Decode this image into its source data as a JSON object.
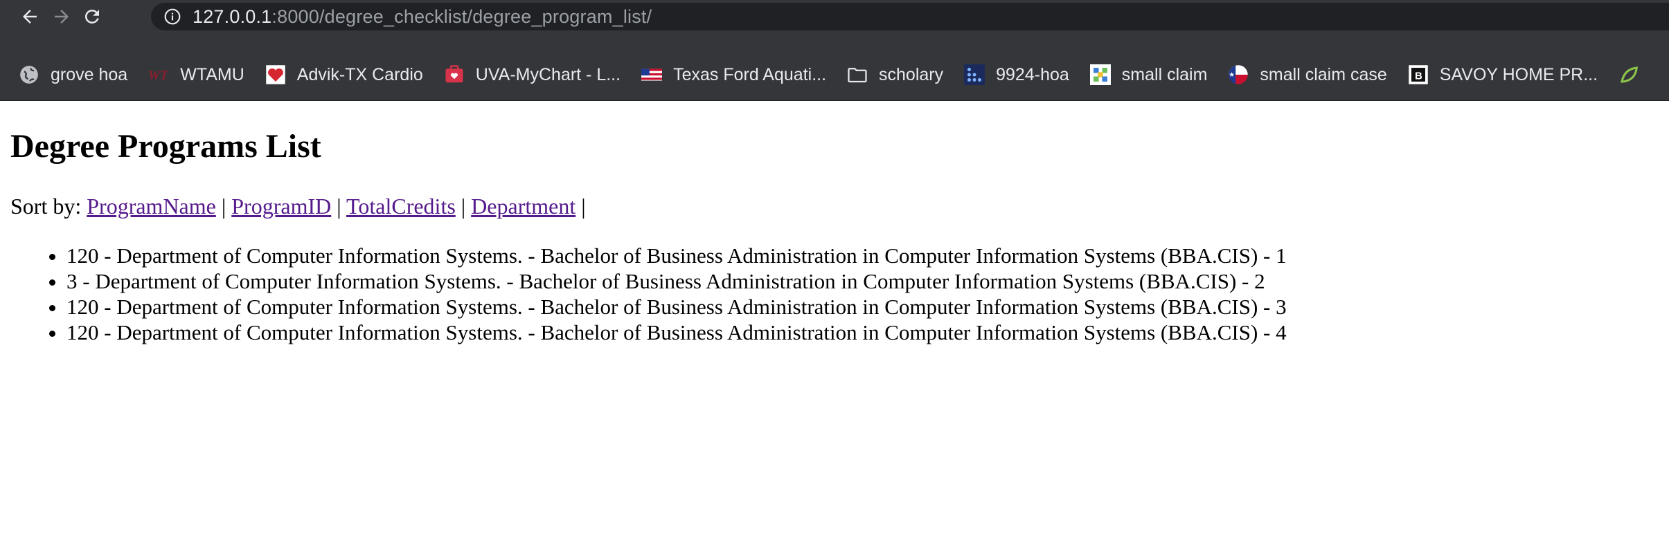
{
  "browser": {
    "url_host": "127.0.0.1",
    "url_path": ":8000/degree_checklist/degree_program_list/",
    "bookmarks": [
      {
        "label": "grove hoa",
        "icon": "globe-icon"
      },
      {
        "label": "WTAMU",
        "icon": "wtamu-logo-icon"
      },
      {
        "label": "Advik-TX Cardio",
        "icon": "heart-balloon-icon"
      },
      {
        "label": "UVA-MyChart - L...",
        "icon": "mychart-icon"
      },
      {
        "label": "Texas Ford Aquati...",
        "icon": "flag-icon"
      },
      {
        "label": "scholary",
        "icon": "folder-icon"
      },
      {
        "label": "9924-hoa",
        "icon": "grid-dots-icon"
      },
      {
        "label": "small claim",
        "icon": "puzzle-icon"
      },
      {
        "label": "small claim case",
        "icon": "texas-flag-icon"
      },
      {
        "label": "SAVOY HOME PR...",
        "icon": "savoy-logo-icon"
      }
    ]
  },
  "page": {
    "title": "Degree Programs List",
    "sort_prefix": "Sort by:",
    "sort_links": [
      "ProgramName",
      "ProgramID",
      "TotalCredits",
      "Department"
    ],
    "separator": "|",
    "programs": [
      "120 - Department of Computer Information Systems. - Bachelor of Business Administration in Computer Information Systems (BBA.CIS) - 1",
      "3 - Department of Computer Information Systems. - Bachelor of Business Administration in Computer Information Systems (BBA.CIS) - 2",
      "120 - Department of Computer Information Systems. - Bachelor of Business Administration in Computer Information Systems (BBA.CIS) - 3",
      "120 - Department of Computer Information Systems. - Bachelor of Business Administration in Computer Information Systems (BBA.CIS) - 4"
    ]
  },
  "colors": {
    "toolbar_bg": "#35363a",
    "omnibox_bg": "#202124",
    "visited_link": "#551a8b"
  }
}
